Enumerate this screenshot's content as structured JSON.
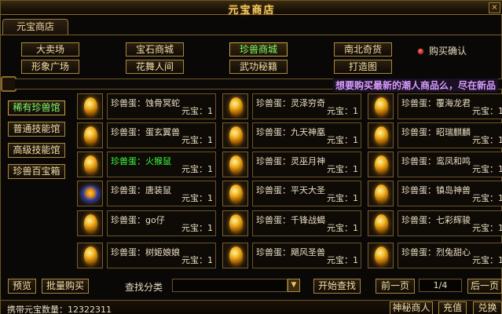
{
  "window": {
    "title": "元宝商店",
    "close_icon": "×"
  },
  "tab": {
    "label": "元宝商店"
  },
  "categories": [
    {
      "label": "大卖场",
      "active": false
    },
    {
      "label": "宝石商城",
      "active": false
    },
    {
      "label": "珍兽商城",
      "active": true
    },
    {
      "label": "南北奇货",
      "active": false
    },
    {
      "label": "形象广场",
      "active": false
    },
    {
      "label": "花舞人间",
      "active": false
    },
    {
      "label": "武功秘籍",
      "active": false
    },
    {
      "label": "打造图",
      "active": false
    }
  ],
  "confirm": {
    "label": "购买确认"
  },
  "marquee": {
    "text": "想要购买最新的潮人商品么，尽在新品"
  },
  "sidebar": [
    {
      "label": "稀有珍兽馆",
      "active": true
    },
    {
      "label": "普通技能馆",
      "active": false
    },
    {
      "label": "高级技能馆",
      "active": false
    },
    {
      "label": "珍兽百宝箱",
      "active": false
    }
  ],
  "items": [
    {
      "name": "珍兽蛋：蚀骨冥蛇",
      "price": "元宝：1",
      "highlight": false,
      "icon": "golden-egg-icon"
    },
    {
      "name": "珍兽蛋：灵泽穷奇",
      "price": "元宝：1",
      "highlight": false,
      "icon": "golden-egg-icon"
    },
    {
      "name": "珍兽蛋：覆海龙君",
      "price": "元宝：1",
      "highlight": false,
      "icon": "golden-egg-icon"
    },
    {
      "name": "珍兽蛋：蛋玄翼兽",
      "price": "元宝：1",
      "highlight": false,
      "icon": "golden-egg-icon"
    },
    {
      "name": "珍兽蛋：九天神凰",
      "price": "元宝：1",
      "highlight": false,
      "icon": "golden-egg-icon"
    },
    {
      "name": "珍兽蛋：昭瑞麒麟",
      "price": "元宝：1",
      "highlight": false,
      "icon": "golden-egg-icon"
    },
    {
      "name": "珍兽蛋：火猴鼠",
      "price": "元宝：1",
      "highlight": true,
      "icon": "golden-egg-icon"
    },
    {
      "name": "珍兽蛋：灵巫月神",
      "price": "元宝：1",
      "highlight": false,
      "icon": "golden-egg-icon"
    },
    {
      "name": "珍兽蛋：鸾凤和鸣",
      "price": "元宝：1",
      "highlight": false,
      "icon": "golden-egg-icon"
    },
    {
      "name": "珍兽蛋：唐装鼠",
      "price": "元宝：1",
      "highlight": false,
      "icon": "blue-egg-icon"
    },
    {
      "name": "珍兽蛋：平天大圣",
      "price": "元宝：1",
      "highlight": false,
      "icon": "golden-egg-icon"
    },
    {
      "name": "珍兽蛋：镇岛神兽",
      "price": "元宝：1",
      "highlight": false,
      "icon": "golden-egg-icon"
    },
    {
      "name": "珍兽蛋：go仔",
      "price": "元宝：1",
      "highlight": false,
      "icon": "golden-egg-icon"
    },
    {
      "name": "珍兽蛋：千锋战蝎",
      "price": "元宝：1",
      "highlight": false,
      "icon": "golden-egg-icon"
    },
    {
      "name": "珍兽蛋：七彩辉骏",
      "price": "元宝：1",
      "highlight": false,
      "icon": "golden-egg-icon"
    },
    {
      "name": "珍兽蛋：树姬娘娘",
      "price": "元宝：1",
      "highlight": false,
      "icon": "golden-egg-icon"
    },
    {
      "name": "珍兽蛋：飓风圣兽",
      "price": "元宝：1",
      "highlight": false,
      "icon": "golden-egg-icon"
    },
    {
      "name": "珍兽蛋：烈兔甜心",
      "price": "元宝：1",
      "highlight": false,
      "icon": "golden-egg-icon"
    }
  ],
  "bottom": {
    "preview": "预览",
    "bulk_buy": "批量购买",
    "search_label": "查找分类",
    "search_value": "",
    "dropdown_icon": "▼",
    "start_search": "开始查找",
    "prev_page": "前一页",
    "page": "1/4",
    "next_page": "后一页"
  },
  "status": {
    "balance": "携带元宝数量：12322311",
    "mystery_merchant": "神秘商人",
    "recharge": "充值",
    "exchange": "兑换"
  }
}
